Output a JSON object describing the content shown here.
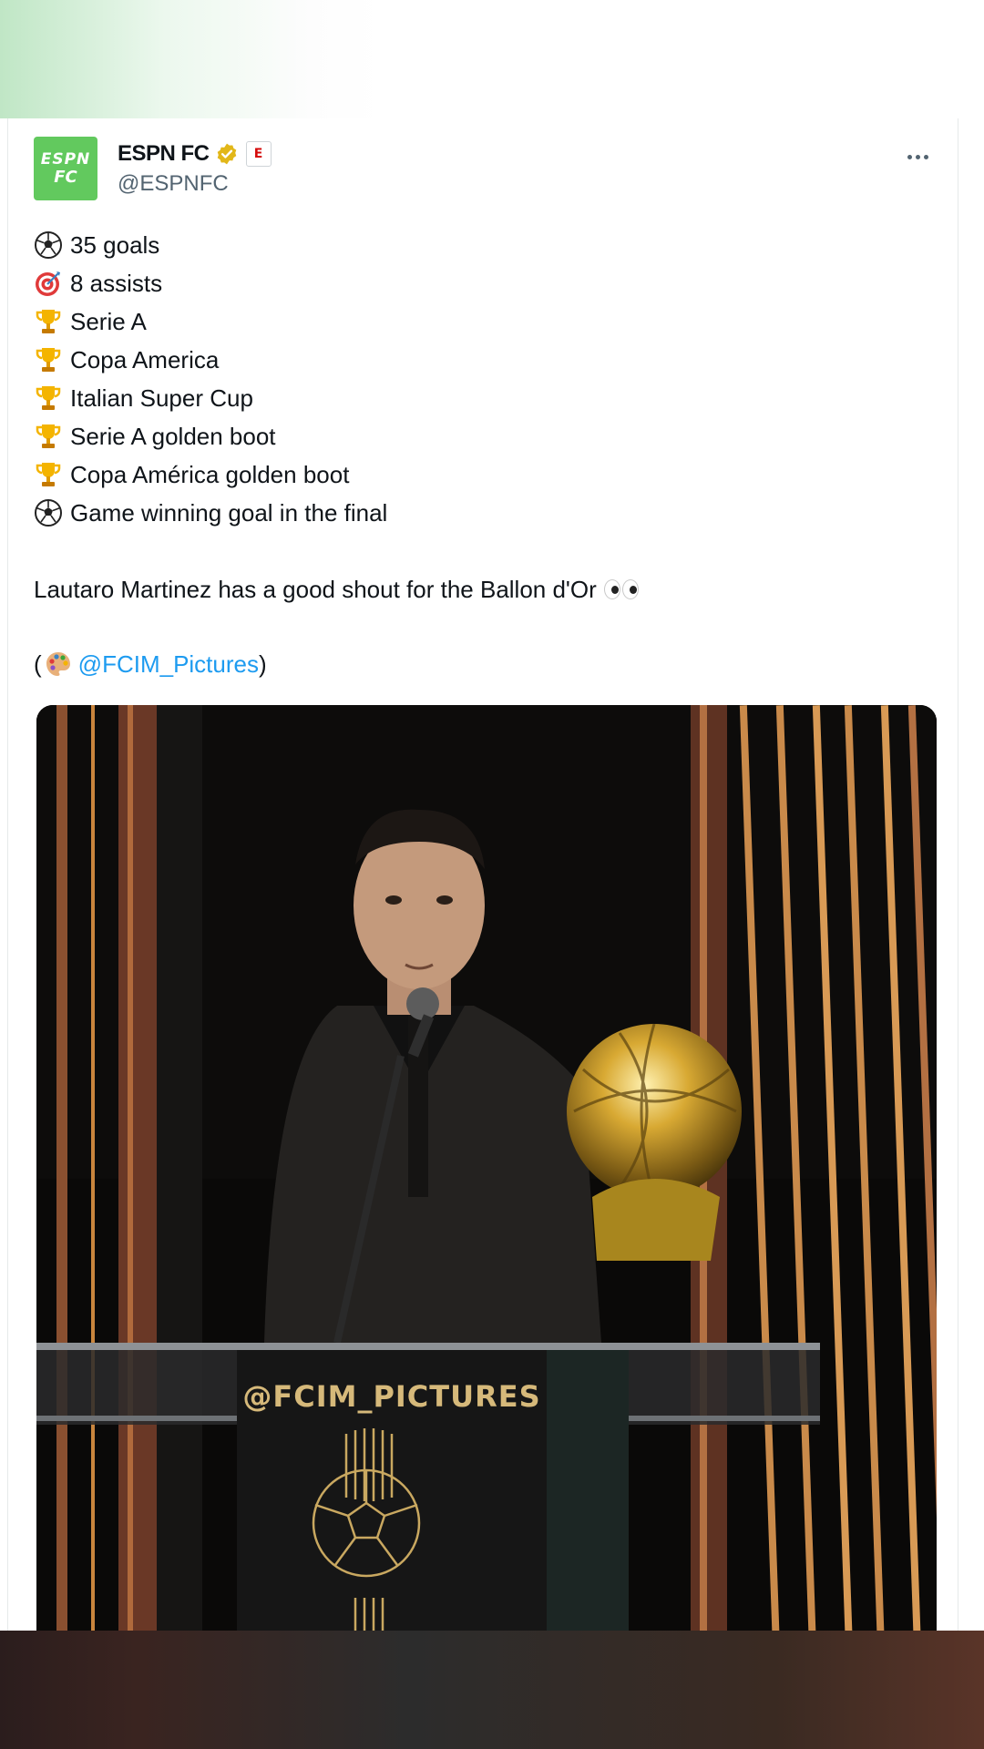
{
  "tweet": {
    "author": {
      "name": "ESPN FC",
      "handle": "@ESPNFC",
      "logo_line1": "ESPN",
      "logo_line2": "FC",
      "affiliate_badge": "E"
    },
    "stats": [
      {
        "icon": "soccer-ball-icon",
        "text": "35 goals"
      },
      {
        "icon": "direct-hit-target-icon",
        "text": "8 assists"
      },
      {
        "icon": "trophy-icon",
        "text": "Serie A"
      },
      {
        "icon": "trophy-icon",
        "text": "Copa America"
      },
      {
        "icon": "trophy-icon",
        "text": "Italian Super Cup"
      },
      {
        "icon": "trophy-icon",
        "text": "Serie A golden boot"
      },
      {
        "icon": "trophy-icon",
        "text": "Copa América golden boot"
      },
      {
        "icon": "soccer-ball-icon",
        "text": "Game winning goal in the final"
      }
    ],
    "paragraph": "Lautaro Martinez has a good shout for the Ballon d'Or",
    "credit": {
      "open": "(",
      "mention": "@FCIM_Pictures",
      "close": ")"
    },
    "image": {
      "podium_text": "@FCIM_PICTURES"
    }
  },
  "colors": {
    "link": "#1d9bf0",
    "text": "#0f1419",
    "secondary_text": "#536471",
    "espn_green": "#62c95e",
    "verified_gold": "#e2b719"
  }
}
